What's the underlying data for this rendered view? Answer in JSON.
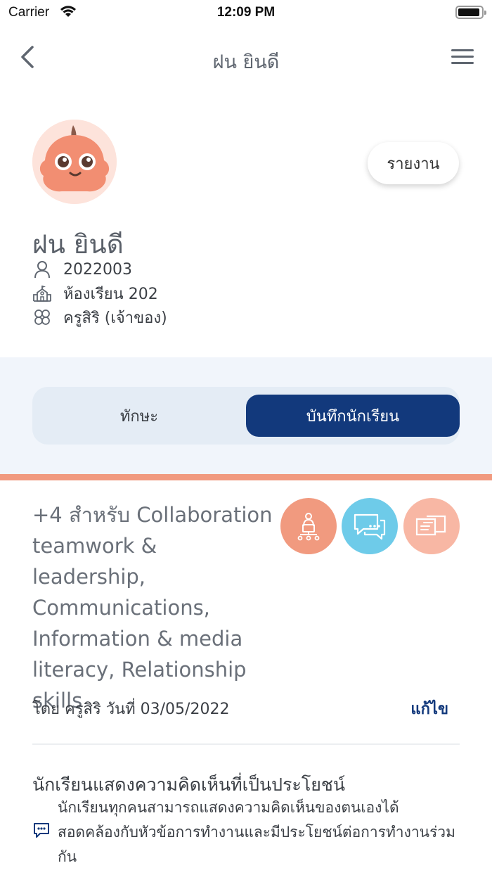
{
  "status_bar": {
    "carrier": "Carrier",
    "time": "12:09 PM",
    "icons": [
      "wifi-icon",
      "battery-icon"
    ]
  },
  "nav": {
    "title": "ฝน ยินดี",
    "icons": [
      "back-chevron-icon",
      "hamburger-menu-icon"
    ]
  },
  "profile": {
    "name": "ฝน ยินดี",
    "student_id": "2022003",
    "classroom": "ห้องเรียน 202",
    "teacher": "ครูสิริ (เจ้าของ)",
    "report_label": "รายงาน",
    "icons": [
      "user-icon",
      "school-icon",
      "group-icon"
    ]
  },
  "tabs": [
    {
      "label": "ทักษะ",
      "active": false
    },
    {
      "label": "บันทึกนักเรียน",
      "active": true
    }
  ],
  "colors": {
    "primary": "#12397c",
    "accent": "#f19a7f",
    "skill_blue": "#6ecbe9",
    "skill_peach": "#f8b7a4",
    "tab_band": "#f1f5fb"
  },
  "note": {
    "title": "+4 สำหรับ Collaboration teamwork & leadership, Communications, Information & media literacy, Relationship skills",
    "meta": "โดย ครูสิริ วันที่ 03/05/2022",
    "edit_label": "แก้ไข",
    "skill_icons": [
      "presenter-icon",
      "chat-icon",
      "handshake-icon"
    ]
  },
  "behavior": {
    "title": "นักเรียนแสดงความคิดเห็นที่เป็นประโยชน์",
    "description": "นักเรียนทุกคนสามารถแสดงความคิดเห็นของตนเองได้ สอดคล้องกับหัวข้อการทำงานและมีประโยชน์ต่อการทำงานร่วมกัน",
    "icon": "comment-icon"
  }
}
